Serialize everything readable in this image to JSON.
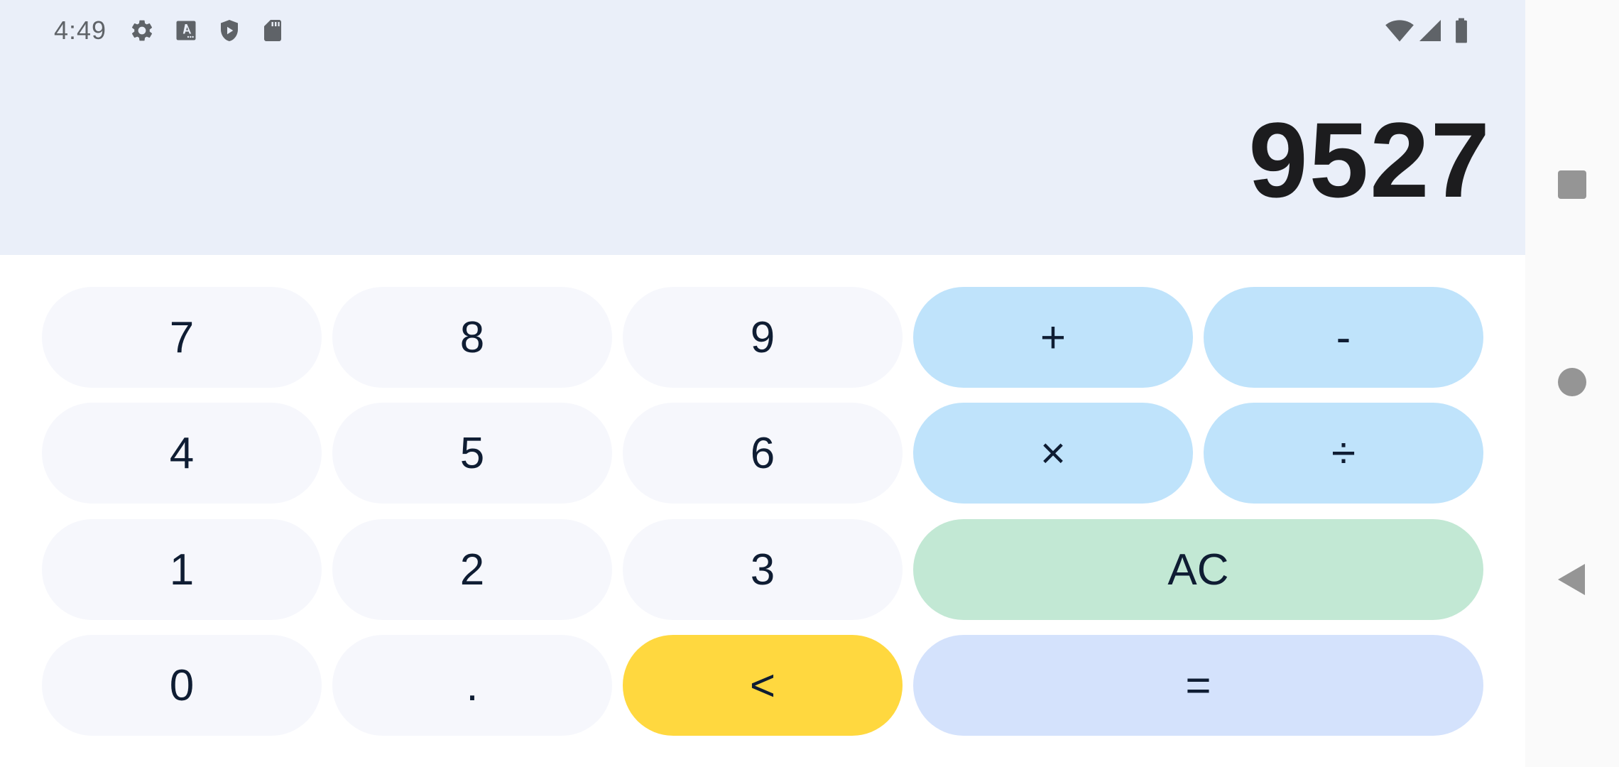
{
  "status_bar": {
    "time": "4:49",
    "icons": [
      "gear-icon",
      "font-download-icon",
      "play-protect-icon",
      "sd-card-icon",
      "wifi-icon",
      "signal-icon",
      "battery-icon"
    ]
  },
  "display": {
    "result": "9527"
  },
  "keypad": {
    "key_7": "7",
    "key_8": "8",
    "key_9": "9",
    "key_plus": "+",
    "key_minus": "-",
    "key_4": "4",
    "key_5": "5",
    "key_6": "6",
    "key_multiply": "×",
    "key_divide": "÷",
    "key_1": "1",
    "key_2": "2",
    "key_3": "3",
    "key_clear": "AC",
    "key_0": "0",
    "key_dot": ".",
    "key_backspace": "<",
    "key_equals": "="
  },
  "colors": {
    "display_background": "#eaeff9",
    "digit_key": "#f6f7fc",
    "operator_key": "#bfe3fb",
    "clear_key": "#c2e8d4",
    "backspace_key": "#ffd83f",
    "equals_key": "#d4e2fc",
    "key_text": "#0f1d33"
  },
  "navigation": {
    "buttons": [
      "recents-button",
      "home-button",
      "back-button"
    ]
  }
}
